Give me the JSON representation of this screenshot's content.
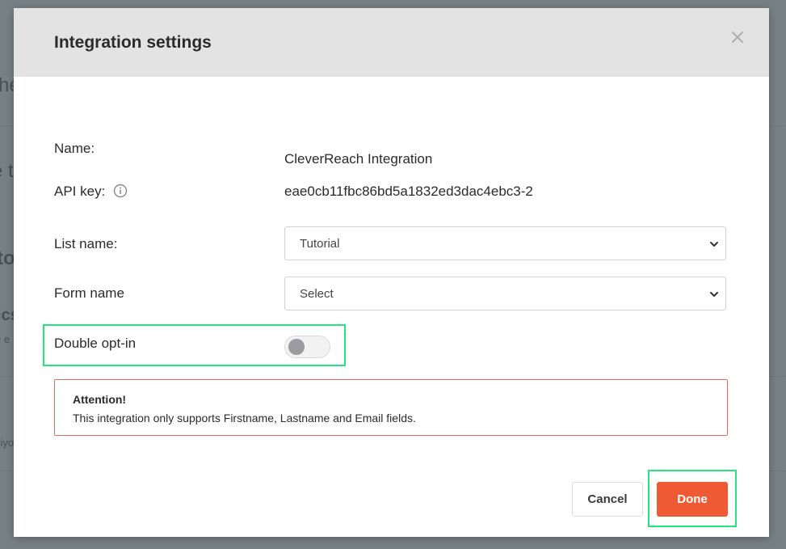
{
  "background": {
    "fragments": [
      "he",
      "e t",
      "to",
      "ics",
      "e e",
      "viyo"
    ]
  },
  "modal": {
    "title": "Integration settings",
    "close_icon": "close-icon",
    "fields": {
      "name_label": "Name:",
      "name_value": "CleverReach Integration",
      "api_key_label": "API key:",
      "api_key_value": "eae0cb11fbc86bd5a1832ed3dac4ebc3-2",
      "info_icon": "info-circle-icon",
      "list_name_label": "List name:",
      "list_name_selected": "Tutorial",
      "form_name_label": "Form name",
      "form_name_selected": "Select",
      "double_optin_label": "Double opt-in",
      "double_optin_enabled": false
    },
    "alert": {
      "title": "Attention!",
      "text": "This integration only supports Firstname, Lastname and Email fields."
    },
    "buttons": {
      "cancel_label": "Cancel",
      "done_label": "Done"
    },
    "colors": {
      "accent": "#ee5a33",
      "highlight": "#22e67d",
      "alert_border": "#e26a5c",
      "header_bg": "#e3e3e3"
    }
  }
}
